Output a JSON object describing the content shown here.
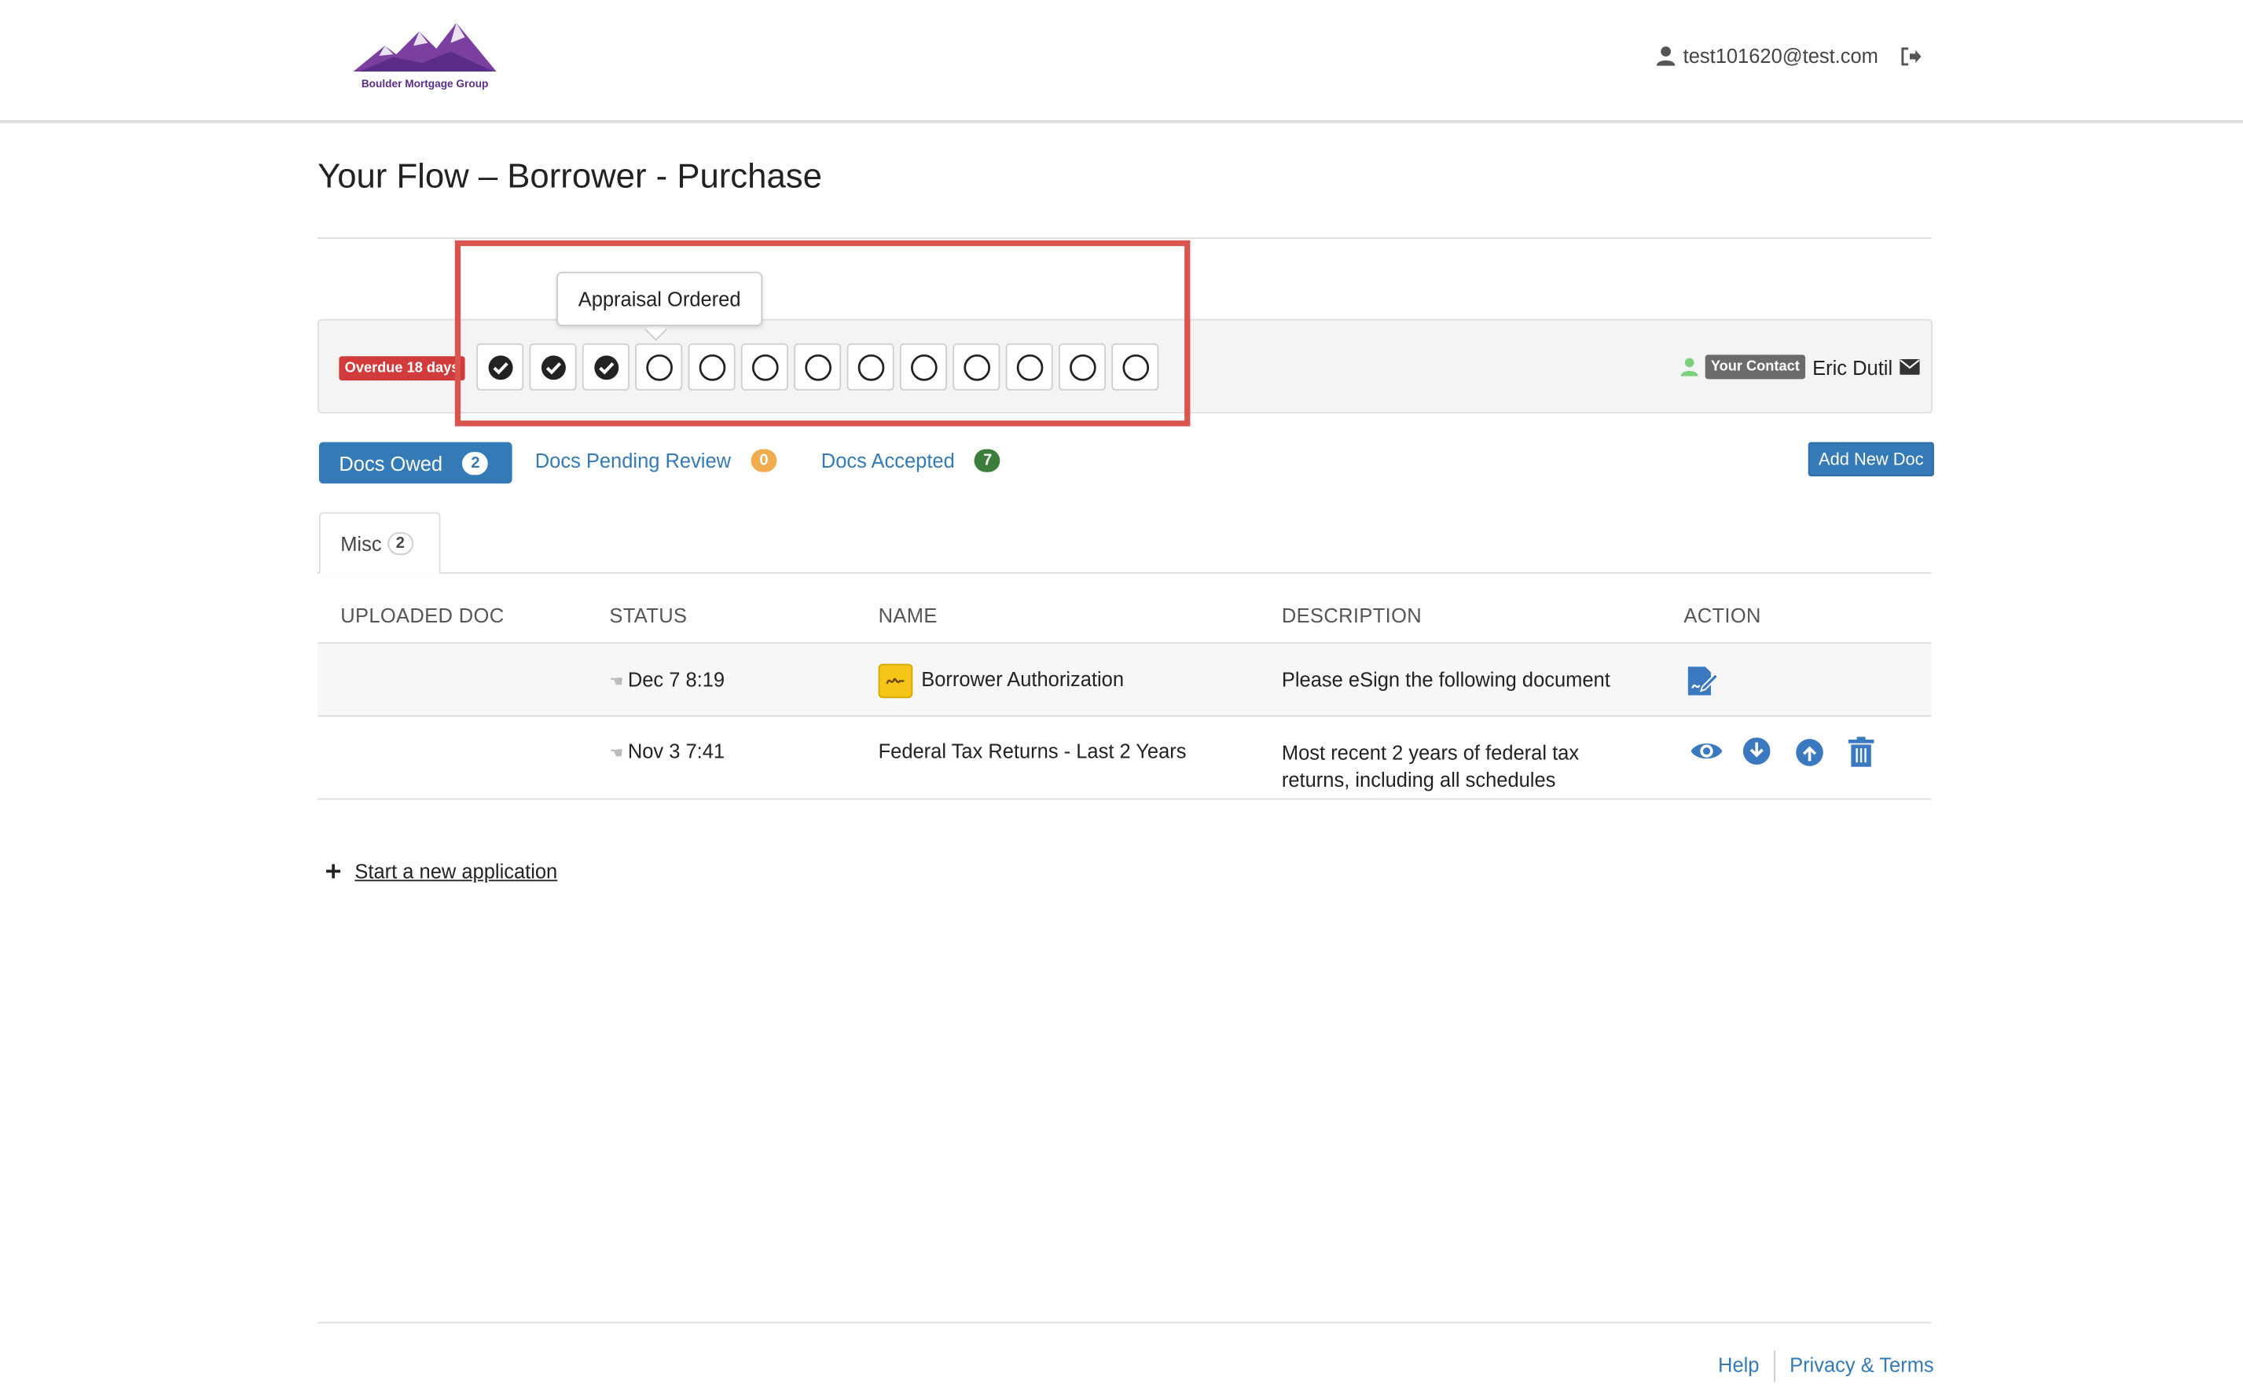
{
  "header": {
    "logo_text": "Boulder Mortgage Group",
    "user_email": "test101620@test.com"
  },
  "page": {
    "title": "Your Flow – Borrower - Purchase"
  },
  "flow": {
    "overdue_label": "Overdue 18 days",
    "steps_completed": 3,
    "steps_total": 13,
    "tooltip": "Appraisal Ordered",
    "contact_badge": "Your Contact",
    "contact_name": "Eric Dutil"
  },
  "doc_tabs": {
    "owed_label": "Docs Owed",
    "owed_count": "2",
    "pending_label": "Docs Pending Review",
    "pending_count": "0",
    "accepted_label": "Docs Accepted",
    "accepted_count": "7",
    "add_button": "Add New Doc"
  },
  "category_tab": {
    "label": "Misc",
    "count": "2"
  },
  "table": {
    "headers": [
      "UPLOADED DOC",
      "STATUS",
      "NAME",
      "DESCRIPTION",
      "ACTION"
    ],
    "rows": [
      {
        "status": "Dec 7 8:19",
        "name": "Borrower Authorization",
        "description": "Please eSign the following document"
      },
      {
        "status": "Nov 3 7:41",
        "name": "Federal Tax Returns - Last 2 Years",
        "description_line1": "Most recent 2 years of federal tax",
        "description_line2": "returns, including all schedules"
      }
    ]
  },
  "new_application": "Start a new application",
  "footer": {
    "help": "Help",
    "privacy": "Privacy & Terms"
  },
  "colors": {
    "primary": "#337ab7",
    "danger": "#d13b3b",
    "brand": "#7b3fa0",
    "highlight": "#d9534f"
  }
}
